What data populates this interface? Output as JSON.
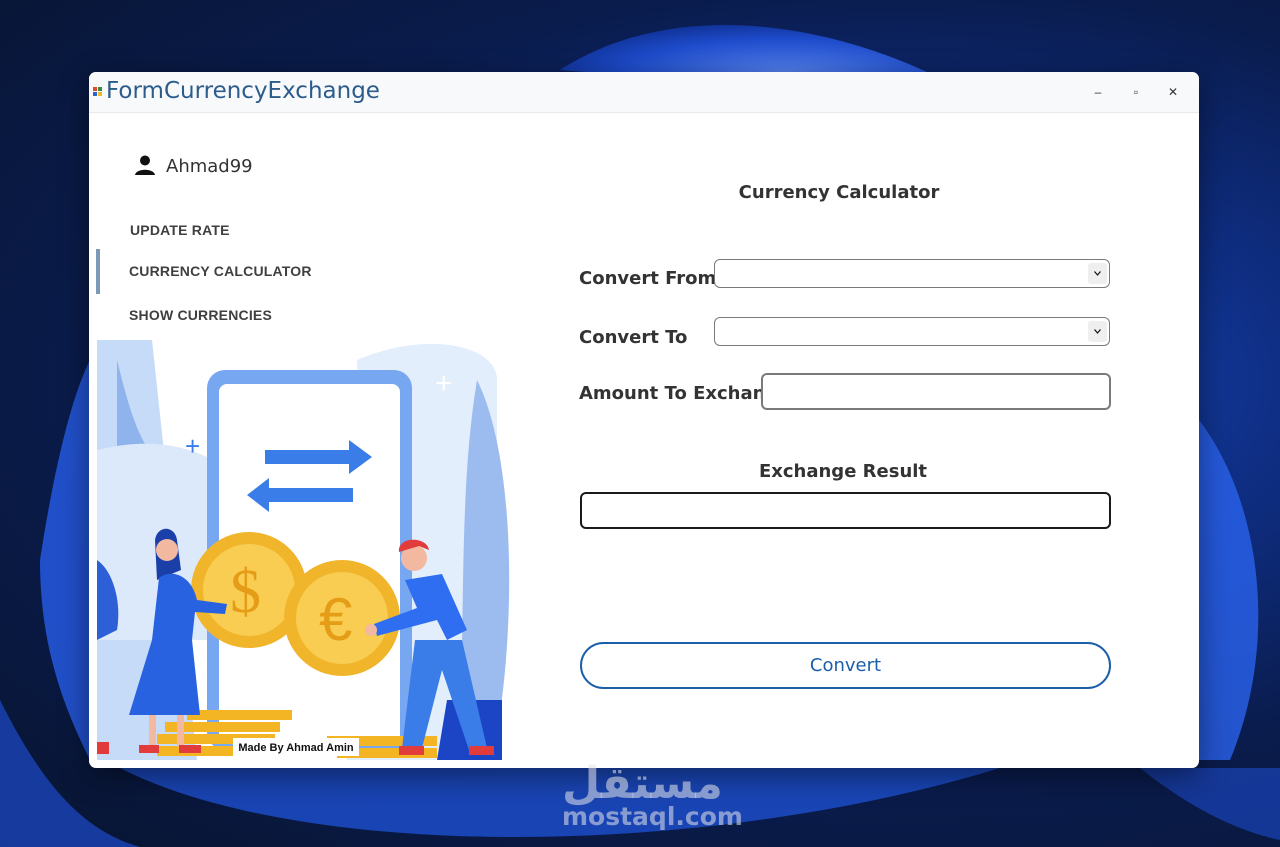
{
  "window": {
    "title": "FormCurrencyExchange",
    "minimize_glyph": "–",
    "maximize_glyph": "▫",
    "close_glyph": "✕"
  },
  "user": {
    "name": "Ahmad99",
    "icon": "user-icon"
  },
  "sidebar": {
    "items": [
      {
        "label": "UPDATE RATE",
        "active": false
      },
      {
        "label": "CURRENCY CALCULATOR",
        "active": true
      },
      {
        "label": "SHOW CURRENCIES",
        "active": false
      }
    ],
    "illustration_credit": "Made By Ahmad Amin"
  },
  "form": {
    "title": "Currency Calculator",
    "convert_from": {
      "label": "Convert From",
      "value": ""
    },
    "convert_to": {
      "label": "Convert To",
      "value": ""
    },
    "amount": {
      "label": "Amount To Exchange",
      "value": ""
    },
    "result": {
      "label": "Exchange Result",
      "value": ""
    },
    "convert_button": "Convert"
  },
  "watermark": {
    "arabic": "مستقل",
    "latin": "mostaql.com"
  },
  "colors": {
    "accent": "#1b5fa8",
    "title_text": "#2c5c8c",
    "nav_indicator": "#7c99b8",
    "illustration_blue": "#3b7de8",
    "coin_gold": "#f6c33b"
  }
}
